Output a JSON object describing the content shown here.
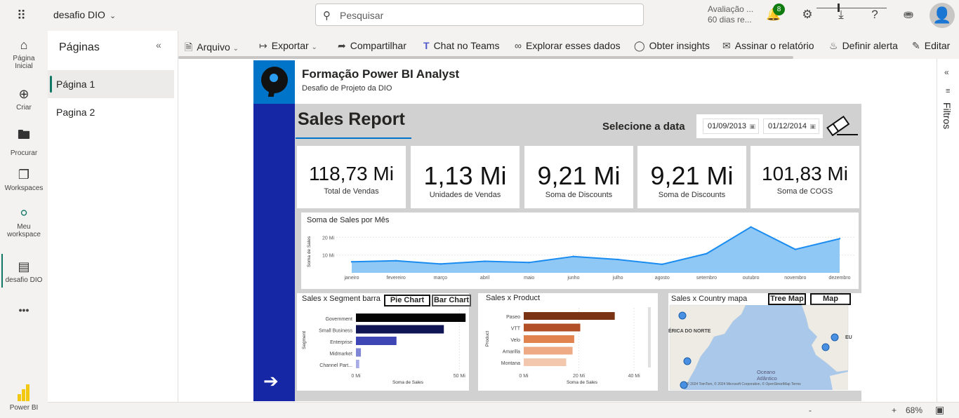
{
  "app": {
    "workspace_name": "desafio DIO",
    "search_placeholder": "Pesquisar",
    "trial_line1": "Avaliação ...",
    "trial_line2": "60 dias re...",
    "notifications": "8"
  },
  "leftnav": [
    {
      "label": "Página\nInicial",
      "icon": "home-icon"
    },
    {
      "label": "Criar",
      "icon": "plus-icon"
    },
    {
      "label": "Procurar",
      "icon": "folder-icon"
    },
    {
      "label": "Workspaces",
      "icon": "workspaces-icon"
    },
    {
      "label": "Meu\nworkspace",
      "icon": "person-icon"
    },
    {
      "label": "desafio DIO",
      "icon": "report-icon"
    }
  ],
  "leftnav_more": "•••",
  "powerbi_label": "Power BI",
  "pages_panel": {
    "title": "Páginas",
    "pages": [
      "Página 1",
      "Pagina 2"
    ]
  },
  "toolbar": {
    "file": "Arquivo",
    "export": "Exportar",
    "share": "Compartilhar",
    "teams": "Chat no Teams",
    "explore": "Explorar esses dados",
    "insights": "Obter insights",
    "subscribe": "Assinar o relatório",
    "alert": "Definir alerta",
    "edit": "Editar"
  },
  "filters_label": "Filtros",
  "status": {
    "zoom": "68%",
    "minus": "-",
    "plus": "+"
  },
  "report": {
    "title": "Formação Power BI Analyst",
    "subtitle": "Desafio de Projeto da DIO",
    "section_title": "Sales Report",
    "date_label": "Selecione a data",
    "date_start": "01/09/2013",
    "date_end": "01/12/2014",
    "kpis": [
      {
        "value": "118,73 Mi",
        "label": "Total de Vendas"
      },
      {
        "value": "1,13 Mi",
        "label": "Unidades de Vendas"
      },
      {
        "value": "9,21 Mi",
        "label": "Soma de Discounts"
      },
      {
        "value": "9,21 Mi",
        "label": "Soma de Discounts"
      },
      {
        "value": "101,83 Mi",
        "label": "Soma de COGS"
      }
    ],
    "segment_title": "Sales x Segment barra",
    "btn_pie": "Pie Chart",
    "btn_bar": "Bar Chart",
    "product_title": "Sales x Product",
    "country_title": "Sales x Country mapa",
    "btn_tree": "Tree Map",
    "btn_map": "Map",
    "map_labels": {
      "na": "ÉRICA DO NORTE",
      "ocean1": "Oceano",
      "ocean2": "Atlântico",
      "eu": "EU"
    },
    "map_credit": "© 2024 TomTom, © 2024 Microsoft Corporation, © OpenStreetMap  Terms"
  },
  "chart_data": [
    {
      "type": "area",
      "title": "Soma de Sales por Mês",
      "ylabel": "Soma de Sales",
      "xlabel": "",
      "categories": [
        "janeiro",
        "fevereiro",
        "março",
        "abril",
        "maio",
        "junho",
        "julho",
        "agosto",
        "setembro",
        "outubro",
        "novembro",
        "dezembro"
      ],
      "values": [
        6.2,
        6.8,
        5.0,
        6.5,
        5.8,
        9.2,
        7.5,
        4.8,
        10.8,
        25.8,
        13.2,
        19.2
      ],
      "yticks": [
        "10 Mi",
        "20 Mi"
      ],
      "ylim": [
        0,
        30
      ],
      "color": "#1a8cf0",
      "grid": true
    },
    {
      "type": "bar",
      "title": "Sales x Segment barra",
      "xlabel": "Soma de Sales",
      "ylabel": "Segment",
      "categories": [
        "Government",
        "Small Business",
        "Enterprise",
        "Midmarket",
        "Channel Part..."
      ],
      "values": [
        53.0,
        42.5,
        19.6,
        2.4,
        1.6
      ],
      "colors": [
        "#050505",
        "#101556",
        "#3e46b5",
        "#7f86d6",
        "#a7abe6"
      ],
      "xticks": [
        "0 Mi",
        "50 Mi"
      ],
      "xlim": [
        0,
        56
      ]
    },
    {
      "type": "bar",
      "title": "Sales x Product",
      "xlabel": "Soma de Sales",
      "ylabel": "Product",
      "categories": [
        "Paseo",
        "VTT",
        "Velo",
        "Amarilla",
        "Montana"
      ],
      "values": [
        33.0,
        20.5,
        18.3,
        17.7,
        15.4
      ],
      "colors": [
        "#7a3415",
        "#b24f26",
        "#e0834f",
        "#eeaa85",
        "#f3c7ae"
      ],
      "xticks": [
        "0 Mi",
        "20 Mi",
        "40 Mi"
      ],
      "xlim": [
        0,
        42
      ]
    }
  ]
}
